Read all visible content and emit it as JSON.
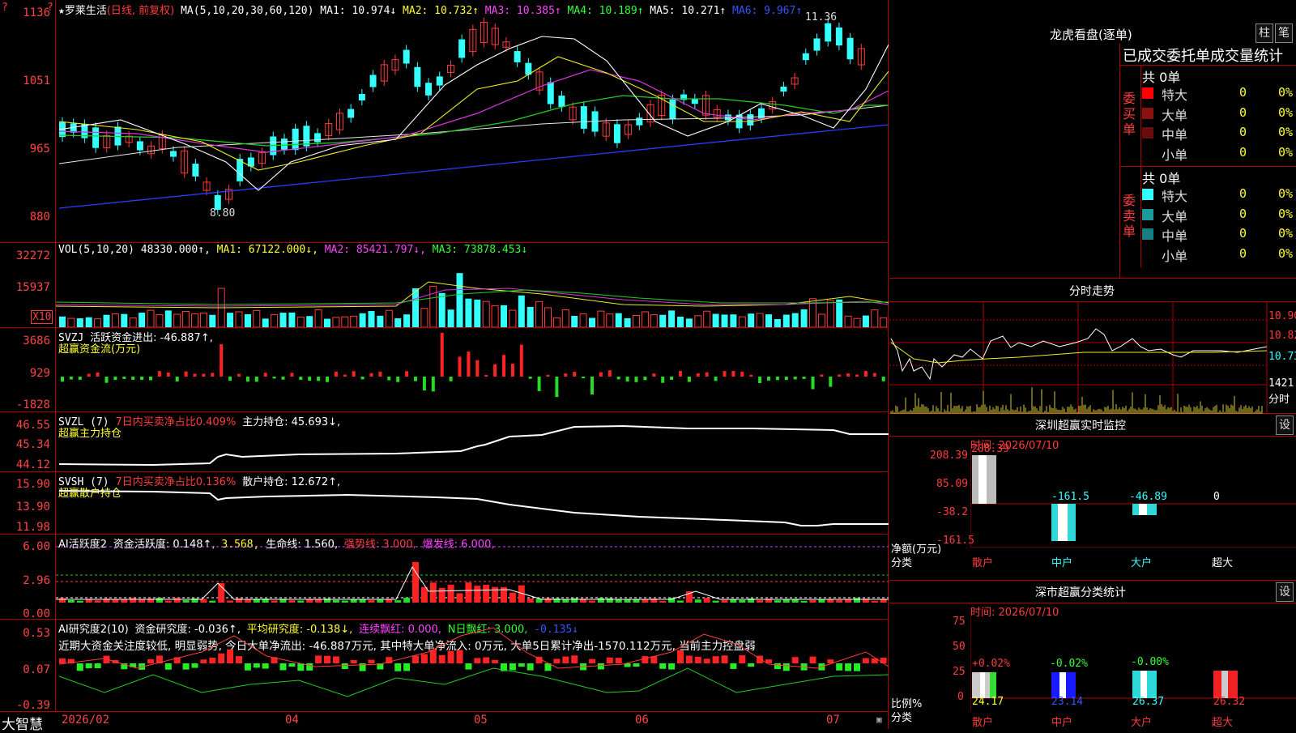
{
  "stock": {
    "name": "罗莱生活",
    "mode": "(日线, 前复权)",
    "ma_label": "MA(5,10,20,30,60,120)",
    "ma1": "MA1: 10.974↓",
    "ma2": "MA2: 10.732↑",
    "ma3": "MA3: 10.385↑",
    "ma4": "MA4: 10.189↑",
    "ma5": "MA5: 10.271↑",
    "ma6": "MA6: 9.967↑",
    "high_mark": "11.36",
    "low_mark": "8.80",
    "y_ticks": [
      "1136",
      "1051",
      "965",
      "880"
    ]
  },
  "vol": {
    "label": "VOL(5,10,20)",
    "value": "48330.000↑,",
    "ma1": "MA1: 67122.000↓,",
    "ma2": "MA2: 85421.797↓,",
    "ma3": "MA3: 73878.453↓",
    "y_ticks": [
      "32272",
      "15937"
    ],
    "unit": "X10"
  },
  "svzj": {
    "label": "SVZJ",
    "value": "活跃资金进出: -46.887↑,",
    "subtitle": "超赢资金流(万元)",
    "y_ticks": [
      "3686",
      "929",
      "-1828"
    ]
  },
  "svzl": {
    "label": "SVZL (7)",
    "ratio": "7日内买卖净占比0.409%",
    "hold": "主力持仓: 45.693↓,",
    "subtitle": "超赢主力持仓",
    "y_ticks": [
      "46.55",
      "45.34",
      "44.12"
    ]
  },
  "svsh": {
    "label": "SVSH (7)",
    "ratio": "7日内买卖净占比0.136%",
    "hold": "散户持仓: 12.672↑,",
    "subtitle": "超赢散户持仓",
    "y_ticks": [
      "15.90",
      "13.90",
      "11.98"
    ]
  },
  "ai_active": {
    "label": "AI活跃度2",
    "value": "资金活跃度: 0.148↑,",
    "v2": "3.568,",
    "life": "生命线: 1.560,",
    "strong": "强势线: 3.000,",
    "burst": "爆发线: 6.000,",
    "y_ticks": [
      "6.00",
      "2.96",
      "0.00"
    ]
  },
  "ai_research": {
    "label": "AI研究度2(10)",
    "value": "资金研究度: -0.036↑,",
    "avg": "平均研究度: -0.138↓,",
    "red": "连续飘红: 0.000,",
    "nred": "N日飘红: 3.000,",
    "v5": "-0.135↓",
    "desc": "近期大资金关注度较低, 明显弱势, 今日大单净流出: -46.887万元, 其中特大单净流入: 0万元, 大单5日累计净出-1570.112万元, 当前主力控盘弱",
    "y_ticks": [
      "0.53",
      "0.07",
      "-0.39"
    ]
  },
  "x_axis": {
    "brand": "大智慧",
    "labels": [
      "2026/02",
      "04",
      "05",
      "06",
      "07"
    ]
  },
  "lhb": {
    "title": "龙虎看盘(逐单)",
    "btn1": "柱",
    "btn2": "笔",
    "tabs": "已成交委托单成交量统计",
    "buy_side": "委买单",
    "sell_side": "委卖单",
    "buy_total": "共 0单",
    "sell_total": "共 0单",
    "rows": [
      "特大",
      "大单",
      "中单",
      "小单"
    ],
    "zero": "0",
    "pct": "0%"
  },
  "intraday": {
    "title": "分时走势",
    "y_ticks": [
      "10.90",
      "10.82",
      "10.73"
    ],
    "vol_tick": "1421",
    "vol_unit": "分时"
  },
  "sz_monitor": {
    "title": "深圳超赢实时监控",
    "btn": "设",
    "time": "时间: 2026/07/10",
    "y_ticks": [
      "208.39",
      "85.09",
      "-38.2",
      "-161.5"
    ],
    "vals": [
      "208.39",
      "-161.5",
      "-46.89",
      "0"
    ],
    "unit": "净额(万元)",
    "cat": "分类",
    "cats": [
      "散户",
      "中户",
      "大户",
      "超大"
    ]
  },
  "sz_class": {
    "title": "深市超赢分类统计",
    "btn": "设",
    "time": "时间: 2026/07/10",
    "y_ticks": [
      "75",
      "50",
      "25",
      "0"
    ],
    "top_vals": [
      "+0.02%",
      "-0.02%",
      "-0.00%",
      ""
    ],
    "bot_vals": [
      "24.17",
      "23.14",
      "26.37",
      "26.32"
    ],
    "unit": "比例%",
    "cat": "分类",
    "cats": [
      "散户",
      "中户",
      "大户",
      "超大"
    ]
  }
}
